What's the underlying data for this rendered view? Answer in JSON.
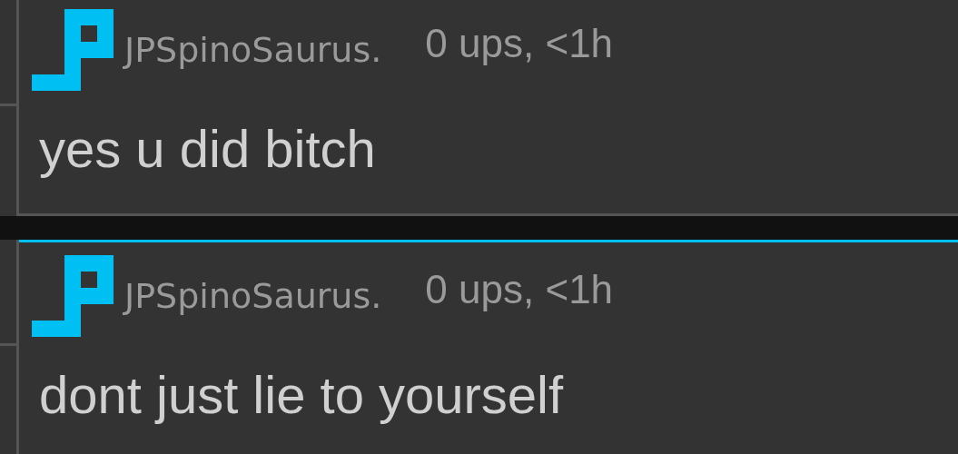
{
  "comments": [
    {
      "author": "JPSpinoSaurus.",
      "meta": "0 ups, <1h",
      "text": "yes u did bitch",
      "highlighted": false
    },
    {
      "author": "JPSpinoSaurus.",
      "meta": "0 ups, <1h",
      "text": "dont just lie to yourself",
      "highlighted": true
    }
  ]
}
